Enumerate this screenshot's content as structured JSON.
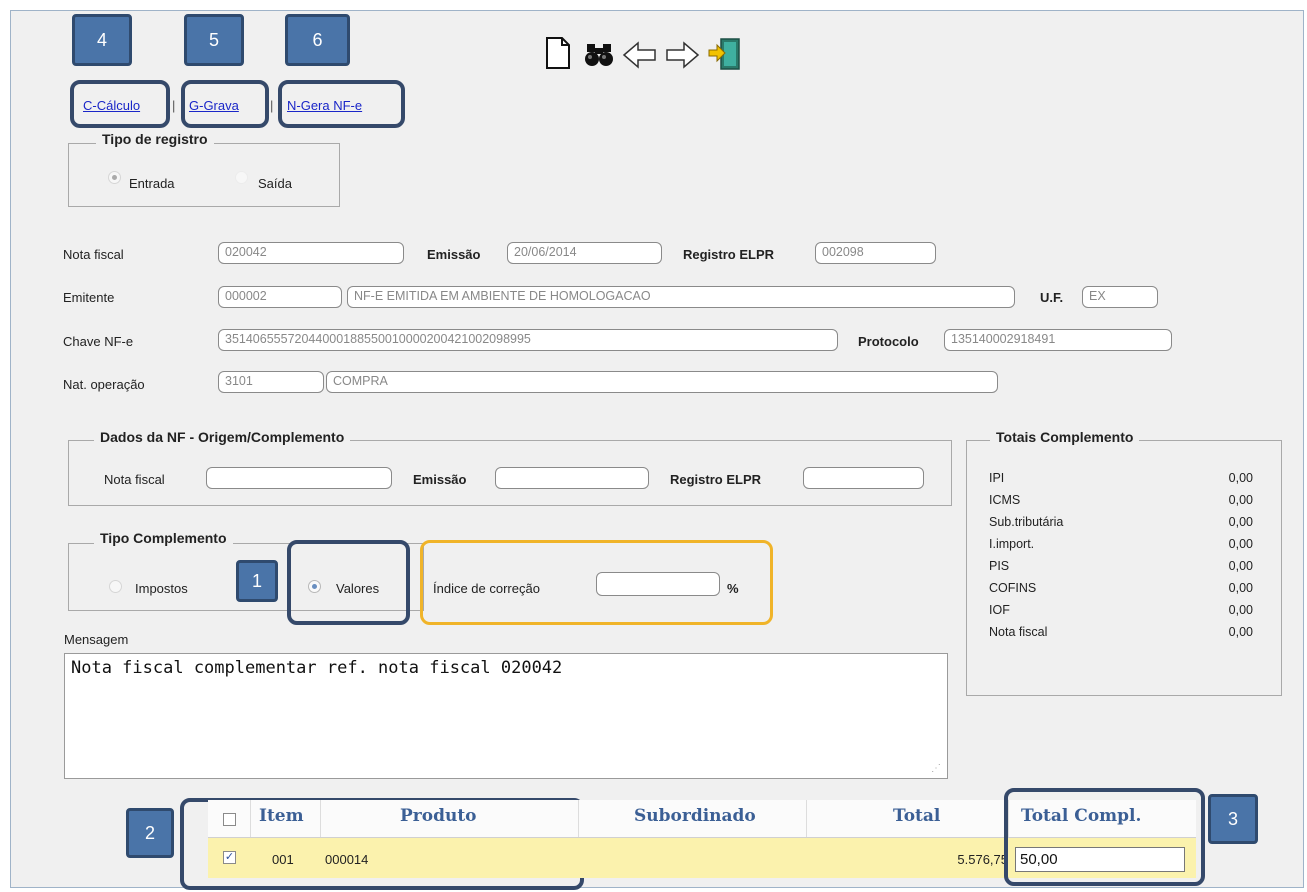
{
  "callouts": {
    "c1": "1",
    "c2": "2",
    "c3": "3",
    "c4": "4",
    "c5": "5",
    "c6": "6"
  },
  "toolbar": {
    "icons": [
      "new-document-icon",
      "search-binoculars-icon",
      "back-arrow-icon",
      "forward-arrow-icon",
      "exit-door-icon"
    ],
    "links": {
      "calculo": "C-Cálculo",
      "grava": "G-Grava",
      "gera_nfe": "N-Gera NF-e"
    },
    "separator": "|"
  },
  "tipo_registro": {
    "legend": "Tipo de registro",
    "entrada": "Entrada",
    "saida": "Saída",
    "selected": "Entrada"
  },
  "form": {
    "nota_fiscal": {
      "label": "Nota fiscal",
      "value": "020042"
    },
    "emissao": {
      "label": "Emissão",
      "value": "20/06/2014"
    },
    "registro_elpr": {
      "label": "Registro ELPR",
      "value": "002098"
    },
    "emitente": {
      "label": "Emitente",
      "code": "000002",
      "name": "NF-E EMITIDA EM AMBIENTE DE HOMOLOGACAO"
    },
    "uf": {
      "label": "U.F.",
      "value": "EX"
    },
    "chave": {
      "label": "Chave NF-e",
      "value": "35140655572044000188550010000200421002098995"
    },
    "protocolo": {
      "label": "Protocolo",
      "value": "135140002918491"
    },
    "nat_operacao": {
      "label": "Nat. operação",
      "code": "3101",
      "desc": "COMPRA"
    }
  },
  "dados_nf": {
    "legend": "Dados da NF - Origem/Complemento",
    "nota_fiscal_label": "Nota fiscal",
    "emissao_label": "Emissão",
    "registro_label": "Registro ELPR",
    "nota_fiscal_value": "",
    "emissao_value": "",
    "registro_value": ""
  },
  "tipo_complemento": {
    "legend": "Tipo Complemento",
    "impostos": "Impostos",
    "valores": "Valores",
    "selected": "Valores",
    "indice_label": "Índice de correção",
    "indice_value": "",
    "percent": "%"
  },
  "mensagem": {
    "label": "Mensagem",
    "text": "Nota fiscal complementar ref. nota fiscal 020042"
  },
  "totais": {
    "legend": "Totais Complemento",
    "rows": [
      {
        "name": "IPI",
        "value": "0,00"
      },
      {
        "name": "ICMS",
        "value": "0,00"
      },
      {
        "name": "Sub.tributária",
        "value": "0,00"
      },
      {
        "name": "I.import.",
        "value": "0,00"
      },
      {
        "name": "PIS",
        "value": "0,00"
      },
      {
        "name": "COFINS",
        "value": "0,00"
      },
      {
        "name": "IOF",
        "value": "0,00"
      },
      {
        "name": "Nota fiscal",
        "value": "0,00"
      }
    ]
  },
  "grid": {
    "headers": {
      "item": "Item",
      "produto": "Produto",
      "subordinado": "Subordinado",
      "total": "Total",
      "total_compl": "Total Compl."
    },
    "rows": [
      {
        "checked": true,
        "item": "001",
        "produto": "000014",
        "subordinado": "",
        "total": "5.576,75",
        "total_compl": "50,00"
      }
    ]
  },
  "colors": {
    "accent": "#4a74a8",
    "highlight": "#35496a",
    "yellow": "#f0b429",
    "link": "#1a26c8",
    "row": "#fbf2ad"
  }
}
